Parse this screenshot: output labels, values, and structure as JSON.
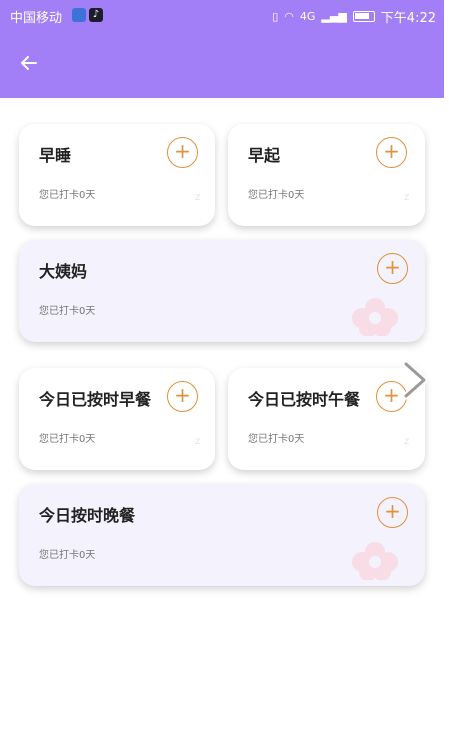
{
  "status_bar": {
    "carrier": "中国移动",
    "network": "4G",
    "time": "下午4:22"
  },
  "colors": {
    "header": "#a27ff7",
    "accent": "#e0913a",
    "card_wide": "#f3f2fd"
  },
  "cards": [
    {
      "title": "早睡",
      "subtitle": "您已打卡0天",
      "icon": "moon-sleep-icon"
    },
    {
      "title": "早起",
      "subtitle": "您已打卡0天",
      "icon": "moon-sleep-icon"
    },
    {
      "title": "大姨妈",
      "subtitle": "您已打卡0天",
      "icon": "flower-icon"
    },
    {
      "title": "今日已按时早餐",
      "subtitle": "您已打卡0天",
      "icon": "moon-sleep-icon"
    },
    {
      "title": "今日已按时午餐",
      "subtitle": "您已打卡0天",
      "icon": "moon-sleep-icon"
    },
    {
      "title": "今日按时晚餐",
      "subtitle": "您已打卡0天",
      "icon": "flower-icon"
    }
  ],
  "add_button_symbol": "+",
  "back_icon": "arrow-left-icon",
  "next_icon": "chevron-right-icon"
}
